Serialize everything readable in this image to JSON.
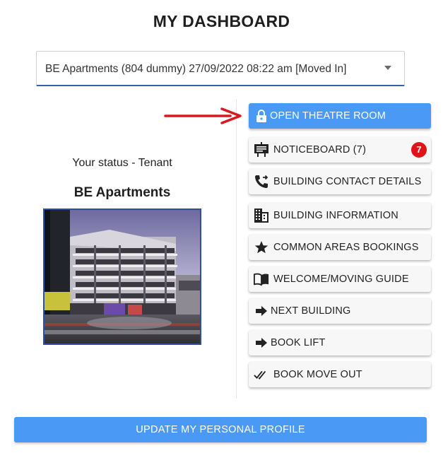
{
  "page": {
    "title": "MY DASHBOARD"
  },
  "apartment_select": {
    "value": "BE Apartments (804 dummy) 27/09/2022 08:22 am [Moved In]"
  },
  "profile": {
    "status": "Your status - Tenant",
    "building_name": "BE Apartments"
  },
  "actions": [
    {
      "label": "OPEN THEATRE ROOM",
      "icon": "lock-icon",
      "style": "primary"
    },
    {
      "label": "NOTICEBOARD (7)",
      "icon": "noticeboard-icon",
      "badge": "7"
    },
    {
      "label": "BUILDING CONTACT DETAILS",
      "icon": "phone-transfer-icon"
    },
    {
      "label": "BUILDING INFORMATION",
      "icon": "building-icon"
    },
    {
      "label": "COMMON AREAS BOOKINGS",
      "icon": "star-icon"
    },
    {
      "label": "WELCOME/MOVING GUIDE",
      "icon": "book-icon"
    },
    {
      "label": "NEXT BUILDING",
      "icon": "arrow-right-icon"
    },
    {
      "label": "BOOK LIFT",
      "icon": "arrow-right-icon"
    },
    {
      "label": "BOOK MOVE OUT",
      "icon": "double-check-icon"
    }
  ],
  "footer": {
    "update_profile_label": "UPDATE MY PERSONAL PROFILE"
  },
  "colors": {
    "primary": "#4a9af5",
    "badge": "#e0131a",
    "annotation_arrow": "#d7191f",
    "select_underline": "#3b5fb5"
  }
}
